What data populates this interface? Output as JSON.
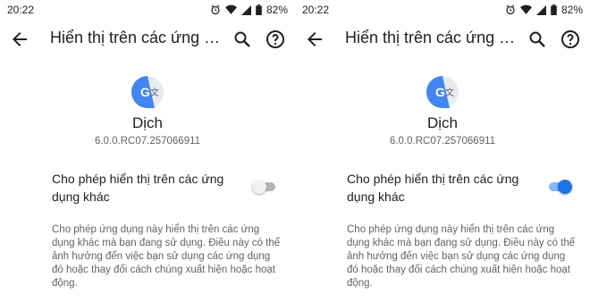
{
  "screens": [
    {
      "status_bar": {
        "time": "20:22",
        "battery": "82%"
      },
      "toolbar": {
        "title": "Hiển thị trên các ứng d...",
        "icons": [
          "back-arrow-icon",
          "search-icon",
          "help-icon"
        ]
      },
      "app": {
        "name": "Dịch",
        "version": "6.0.0.RC07.257066911",
        "icon": "google-translate-icon"
      },
      "setting": {
        "label": "Cho phép hiển thị trên các ứng dụng khác",
        "enabled": false
      },
      "description": "Cho phép ứng dụng này hiển thị trên các ứng dụng khác mà bạn đang sử dụng. Điều này có thể ảnh hưởng đến việc bạn sử dụng các ứng dụng đó hoặc thay đổi cách chúng xuất hiện hoặc hoạt động."
    },
    {
      "status_bar": {
        "time": "20:22",
        "battery": "82%"
      },
      "toolbar": {
        "title": "Hiển thị trên các ứng d...",
        "icons": [
          "back-arrow-icon",
          "search-icon",
          "help-icon"
        ]
      },
      "app": {
        "name": "Dịch",
        "version": "6.0.0.RC07.257066911",
        "icon": "google-translate-icon"
      },
      "setting": {
        "label": "Cho phép hiển thị trên các ứng dụng khác",
        "enabled": true
      },
      "description": "Cho phép ứng dụng này hiển thị trên các ứng dụng khác mà bạn đang sử dụng. Điều này có thể ảnh hưởng đến việc bạn sử dụng các ứng dụng đó hoặc thay đổi cách chúng xuất hiện hoặc hoạt động."
    }
  ],
  "colors": {
    "accent": "#1a73e8",
    "accent_track": "#8ab4f8",
    "text_primary": "#202124",
    "text_secondary": "#5f6368",
    "translate_blue": "#4285f4",
    "translate_gray": "#e8eaed"
  }
}
